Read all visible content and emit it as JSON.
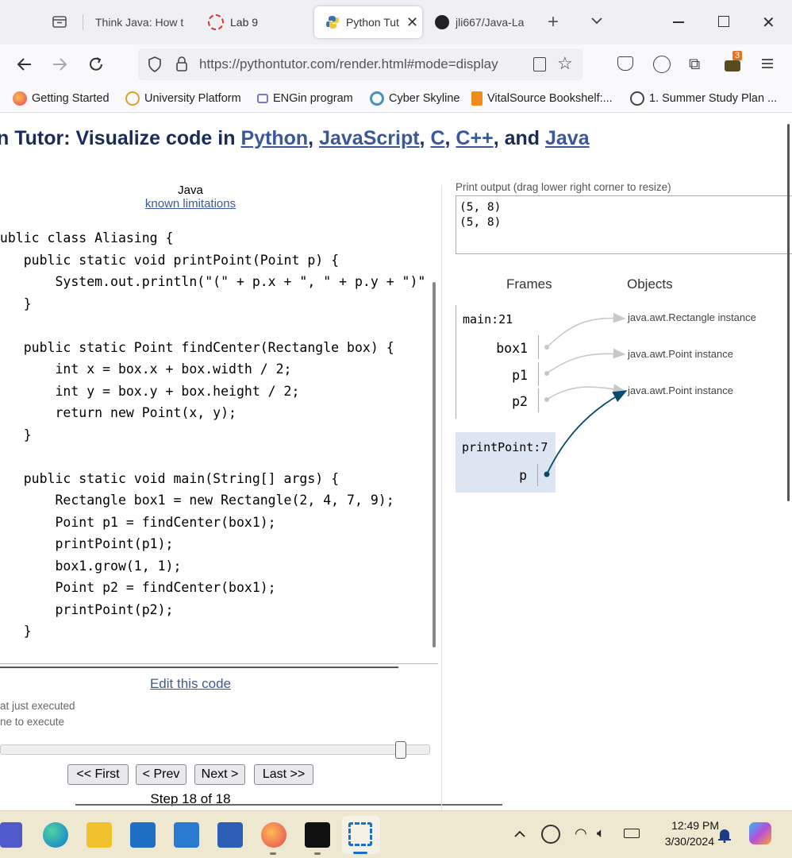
{
  "browser": {
    "tabs": [
      {
        "title": "Think Java: How t"
      },
      {
        "title": "Lab 9"
      },
      {
        "title": "Python Tut"
      },
      {
        "title": "jli667/Java-La"
      }
    ],
    "url": "https://pythontutor.com/render.html#mode=display",
    "extensions_badge": "3",
    "bookmarks": [
      {
        "label": "Getting Started"
      },
      {
        "label": "University Platform"
      },
      {
        "label": "ENGin program"
      },
      {
        "label": "Cyber Skyline"
      },
      {
        "label": "VitalSource Bookshelf:..."
      },
      {
        "label": "1. Summer Study Plan ..."
      }
    ]
  },
  "page": {
    "title_prefix": "n Tutor: Visualize code in ",
    "title_links": [
      "Python",
      "JavaScript",
      "C",
      "C++",
      "Java"
    ],
    "title_sep1": ", ",
    "title_sep2": ", and ",
    "language": "Java",
    "limitations_link": "known limitations",
    "code_lines": [
      "public class Aliasing {",
      "    public static void printPoint(Point p) {",
      "        System.out.println(\"(\" + p.x + \", \" + p.y + \")\"",
      "    }",
      "",
      "    public static Point findCenter(Rectangle box) {",
      "        int x = box.x + box.width / 2;",
      "        int y = box.y + box.height / 2;",
      "        return new Point(x, y);",
      "    }",
      "",
      "    public static void main(String[] args) {",
      "        Rectangle box1 = new Rectangle(2, 4, 7, 9);",
      "        Point p1 = findCenter(box1);",
      "        printPoint(p1);",
      "        box1.grow(1, 1);",
      "        Point p2 = findCenter(box1);",
      "        printPoint(p2);",
      "    }",
      "}"
    ],
    "edit_link": "Edit this code",
    "legend_just_executed": "at just executed",
    "legend_next": "ne to execute",
    "nav": {
      "first": "<< First",
      "prev": "< Prev",
      "next": "Next >",
      "last": "Last >>"
    },
    "step_text": "Step 18 of 18",
    "print_output_label": "Print output (drag lower right corner to resize)",
    "print_output": "(5, 8)\n(5, 8)",
    "frames_header": "Frames",
    "objects_header": "Objects",
    "frames": [
      {
        "name": "main:21",
        "vars": [
          "box1",
          "p1",
          "p2"
        ]
      },
      {
        "name": "printPoint:7",
        "vars": [
          "p"
        ]
      }
    ],
    "objects": [
      {
        "label": "java.awt.Rectangle instance"
      },
      {
        "label": "java.awt.Point instance"
      },
      {
        "label": "java.awt.Point instance"
      }
    ]
  },
  "taskbar": {
    "time": "12:49 PM",
    "date": "3/30/2024"
  }
}
